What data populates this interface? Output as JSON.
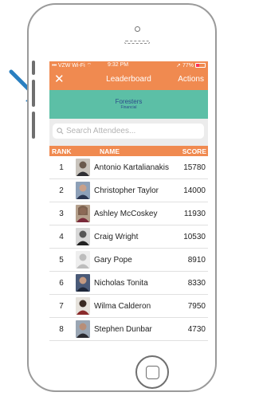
{
  "status": {
    "carrier": "VZW Wi-Fi",
    "time": "9:32 PM",
    "battery": "77%"
  },
  "nav": {
    "close": "✕",
    "title": "Leaderboard",
    "actions": "Actions"
  },
  "banner": {
    "logo_line1": "Foresters",
    "logo_line2": "Financial"
  },
  "search": {
    "placeholder": "Search Attendees..."
  },
  "table": {
    "headers": {
      "rank": "RANK",
      "name": "NAME",
      "score": "SCORE"
    },
    "rows": [
      {
        "rank": "1",
        "name": "Antonio Kartalianakis",
        "score": "15780"
      },
      {
        "rank": "2",
        "name": "Christopher Taylor",
        "score": "14000"
      },
      {
        "rank": "3",
        "name": "Ashley McCoskey",
        "score": "11930"
      },
      {
        "rank": "4",
        "name": "Craig Wright",
        "score": "10530"
      },
      {
        "rank": "5",
        "name": "Gary Pope",
        "score": "8910"
      },
      {
        "rank": "6",
        "name": "Nicholas Tonita",
        "score": "8330"
      },
      {
        "rank": "7",
        "name": "Wilma Calderon",
        "score": "7950"
      },
      {
        "rank": "8",
        "name": "Stephen Dunbar",
        "score": "4730"
      }
    ]
  },
  "colors": {
    "accent": "#f08a50",
    "banner": "#5cbfa6",
    "arrow": "#2a7fc0"
  }
}
